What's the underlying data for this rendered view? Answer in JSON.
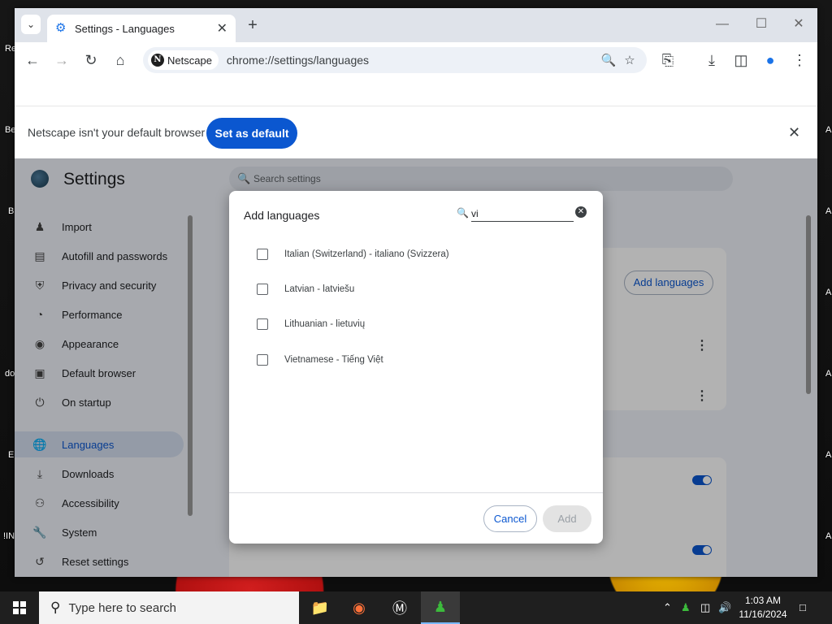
{
  "desktop": {
    "left_labels": [
      "Re",
      "Be",
      "B",
      "do",
      "E",
      "!IN"
    ],
    "right_labels": [
      "A",
      "A",
      "A",
      "A",
      "A",
      "A",
      "A"
    ]
  },
  "browser": {
    "tab": {
      "title": "Settings - Languages",
      "icon": "gear-icon"
    },
    "url": "chrome://settings/languages",
    "site_chip": "Netscape",
    "site_logo_letter": "N"
  },
  "infobar": {
    "message": "Netscape isn't your default browser",
    "button": "Set as default"
  },
  "settings": {
    "title": "Settings",
    "search_placeholder": "Search settings",
    "nav": [
      {
        "label": "Import",
        "icon": "person-icon"
      },
      {
        "label": "Autofill and passwords",
        "icon": "clipboard-icon"
      },
      {
        "label": "Privacy and security",
        "icon": "shield-icon"
      },
      {
        "label": "Performance",
        "icon": "speedometer-icon"
      },
      {
        "label": "Appearance",
        "icon": "palette-icon"
      },
      {
        "label": "Default browser",
        "icon": "browser-icon"
      },
      {
        "label": "On startup",
        "icon": "power-icon"
      },
      {
        "label": "Languages",
        "icon": "globe-icon",
        "active": true
      },
      {
        "label": "Downloads",
        "icon": "download-icon"
      },
      {
        "label": "Accessibility",
        "icon": "accessibility-icon"
      },
      {
        "label": "System",
        "icon": "wrench-icon"
      },
      {
        "label": "Reset settings",
        "icon": "history-icon"
      }
    ],
    "add_languages_button": "Add languages"
  },
  "dialog": {
    "title": "Add languages",
    "search_value": "vi",
    "languages": [
      "Italian (Switzerland) - italiano (Svizzera)",
      "Latvian - latviešu",
      "Lithuanian - lietuvių",
      "Vietnamese - Tiếng Việt"
    ],
    "cancel": "Cancel",
    "add": "Add"
  },
  "taskbar": {
    "search_placeholder": "Type here to search",
    "time": "1:03 AM",
    "date": "11/16/2024"
  },
  "colors": {
    "accent": "#0b57d0",
    "settings_bg": "#f0f3f9",
    "taskbar": "#1f1f1f"
  }
}
